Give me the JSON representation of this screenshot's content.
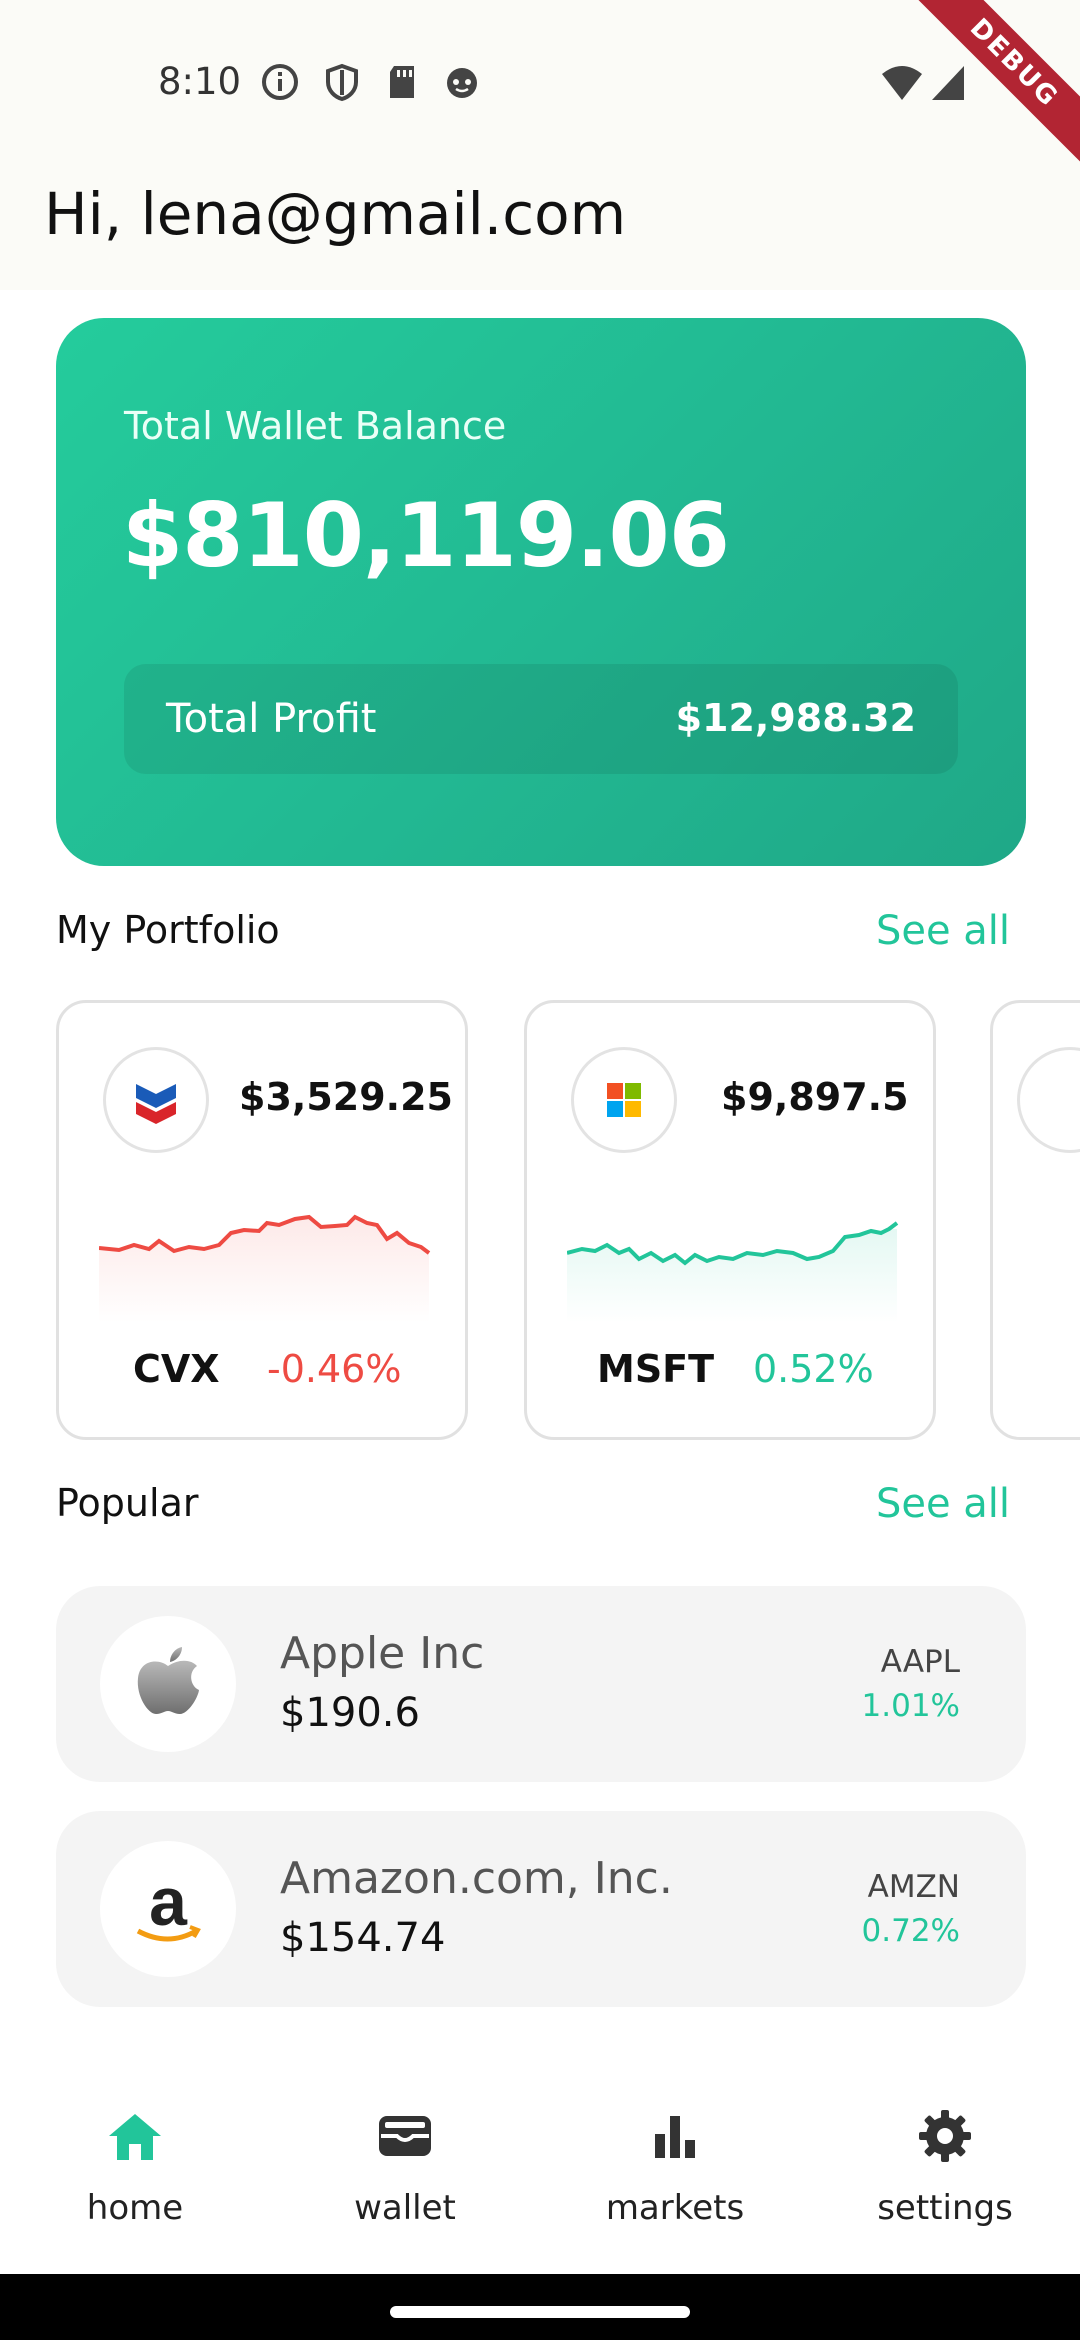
{
  "status_bar": {
    "time": "8:10",
    "icons": [
      "info-circle-icon",
      "shield-icon",
      "sd-card-icon",
      "face-icon",
      "wifi-icon",
      "cell-signal-icon"
    ],
    "debug_banner": "DEBUG"
  },
  "header": {
    "greeting": "Hi, lena@gmail.com"
  },
  "wallet": {
    "label": "Total Wallet Balance",
    "balance": "$810,119.06",
    "profit_label": "Total Profit",
    "profit_value": "$12,988.32"
  },
  "portfolio": {
    "title": "My Portfolio",
    "see_all": "See all",
    "cards": [
      {
        "value": "$3,529.25",
        "ticker": "CVX",
        "change": "-0.46%",
        "trend": "down",
        "color": "#ee4b43"
      },
      {
        "value": "$9,897.5",
        "ticker": "MSFT",
        "change": "0.52%",
        "trend": "up",
        "color": "#22c59a"
      }
    ]
  },
  "popular": {
    "title": "Popular",
    "see_all": "See all",
    "items": [
      {
        "name": "Apple Inc",
        "price": "$190.6",
        "ticker": "AAPL",
        "change": "1.01%"
      },
      {
        "name": "Amazon.com, Inc.",
        "price": "$154.74",
        "ticker": "AMZN",
        "change": "0.72%"
      }
    ]
  },
  "nav": {
    "items": [
      {
        "label": "home",
        "icon": "home-icon",
        "active": true
      },
      {
        "label": "wallet",
        "icon": "wallet-icon",
        "active": false
      },
      {
        "label": "markets",
        "icon": "bar-chart-icon",
        "active": false
      },
      {
        "label": "settings",
        "icon": "gear-icon",
        "active": false
      }
    ]
  },
  "colors": {
    "accent": "#22c59a",
    "negative": "#ee4b43"
  }
}
